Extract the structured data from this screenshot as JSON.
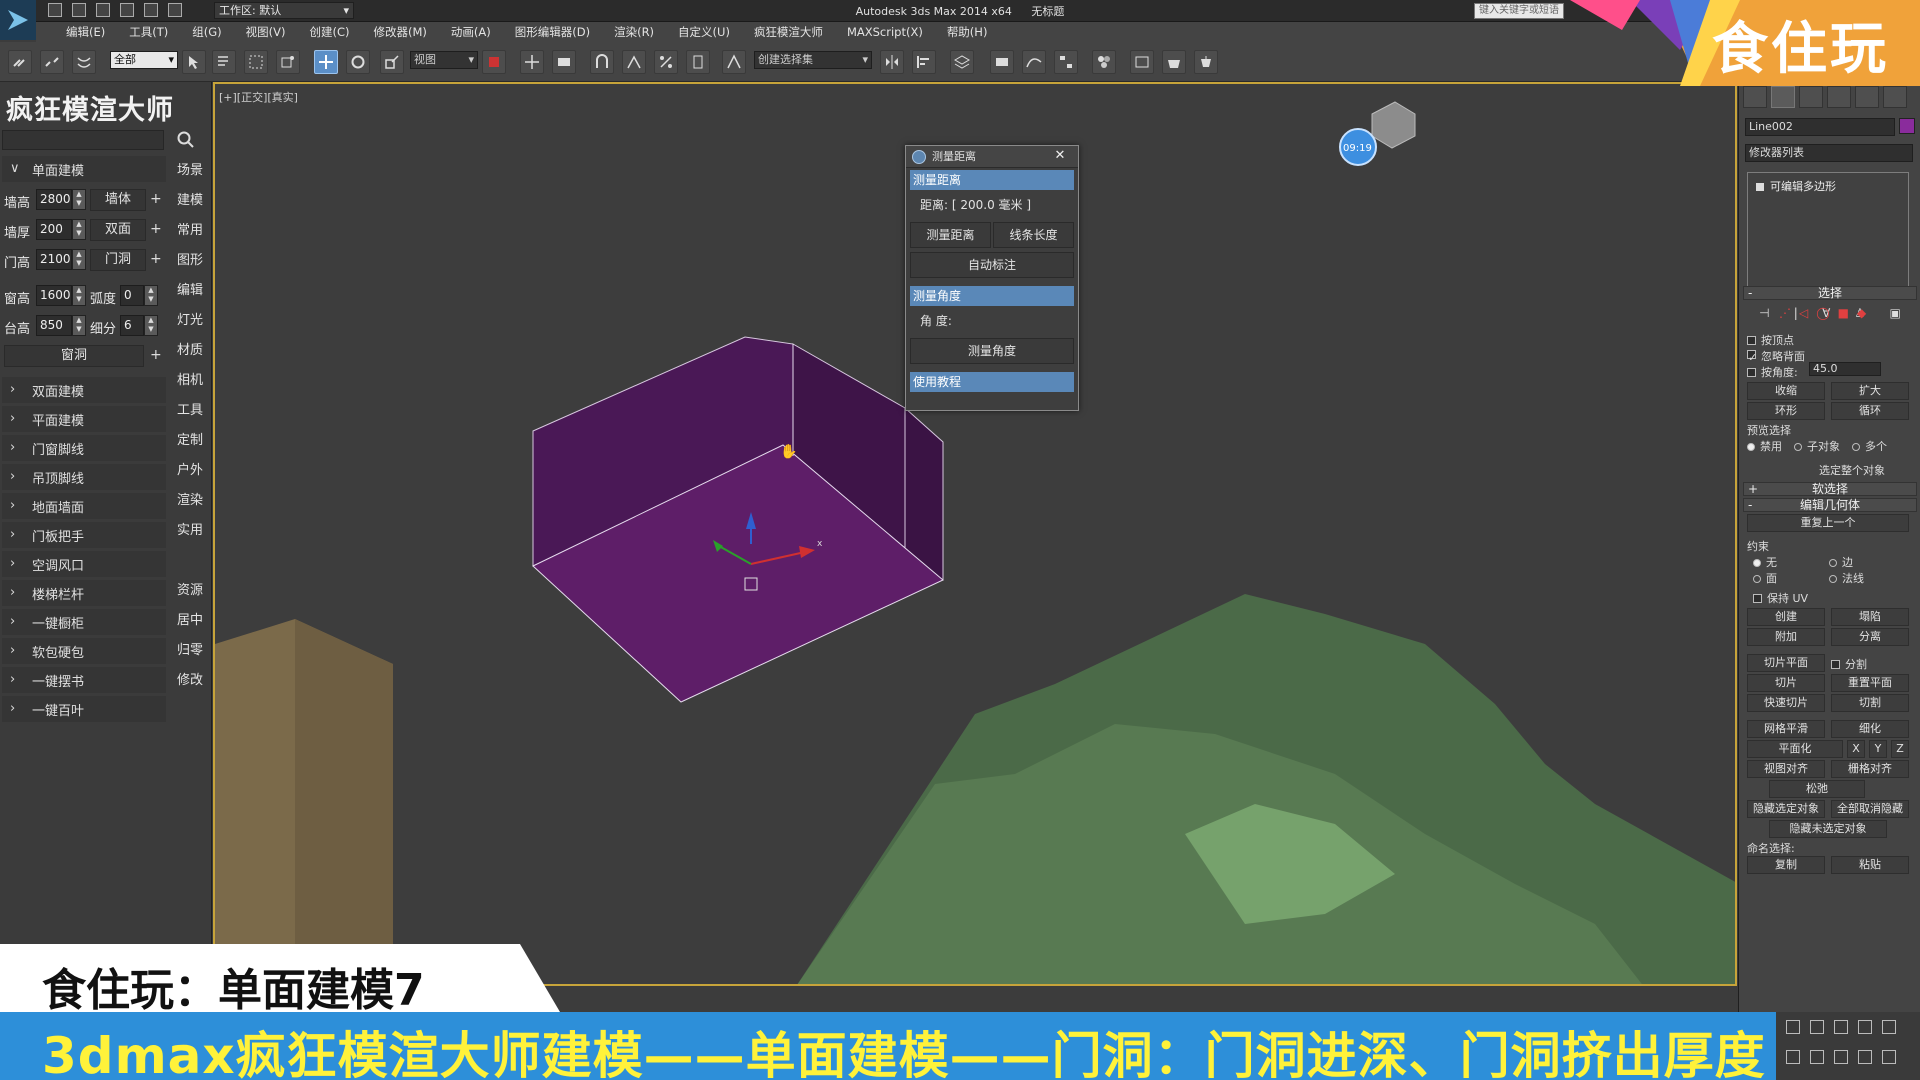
{
  "app": {
    "title_app": "Autodesk 3ds Max  2014 x64",
    "title_file": "无标题",
    "workspace": "工作区: 默认",
    "help_search_placeholder": "键入关键字或短语"
  },
  "menu": [
    "编辑(E)",
    "工具(T)",
    "组(G)",
    "视图(V)",
    "创建(C)",
    "修改器(M)",
    "动画(A)",
    "图形编辑器(D)",
    "渲染(R)",
    "自定义(U)",
    "疯狂模渲大师",
    "MAXScript(X)",
    "帮助(H)"
  ],
  "toolbar": {
    "filter_select": "全部",
    "ref_coord_select": "视图",
    "named_selection": "创建选择集"
  },
  "left_panel": {
    "title": "疯狂模渲大师",
    "section_single": "单面建模",
    "params": {
      "wall_height_label": "墙高",
      "wall_height_value": "2800",
      "wall_body": "墙体",
      "wall_thick_label": "墙厚",
      "wall_thick_value": "200",
      "double_face": "双面",
      "door_height_label": "门高",
      "door_height_value": "2100",
      "door_hole": "门洞",
      "window_height_label": "窗高",
      "window_height_value": "1600",
      "arc_label": "弧度",
      "arc_value": "0",
      "sill_height_label": "台高",
      "sill_height_value": "850",
      "subdiv_label": "细分",
      "subdiv_value": "6",
      "window_hole": "窗洞"
    },
    "sections": [
      "双面建模",
      "平面建模",
      "门窗脚线",
      "吊顶脚线",
      "地面墙面",
      "门板把手",
      "空调风口",
      "楼梯栏杆",
      "一键橱柜",
      "软包硬包",
      "一键摆书",
      "一键百叶"
    ],
    "categories_top": [
      "场景",
      "建模",
      "常用",
      "图形",
      "编辑",
      "灯光",
      "材质",
      "相机",
      "工具",
      "定制",
      "户外",
      "渲染",
      "实用"
    ],
    "categories_bottom": [
      "资源",
      "居中",
      "归零",
      "修改"
    ]
  },
  "viewport": {
    "label": "[+][正交][真实]",
    "clock": "09:19",
    "axis_x": "x"
  },
  "measure_dialog": {
    "title": "测量距离",
    "section_distance": "测量距离",
    "distance_text": "距离: [ 200.0 毫米 ]",
    "btn_measure_distance": "测量距离",
    "btn_line_length": "线条长度",
    "btn_auto_dimension": "自动标注",
    "section_angle": "测量角度",
    "angle_text": "角 度:",
    "btn_measure_angle": "测量角度",
    "section_tutorial": "使用教程"
  },
  "command_panel": {
    "object_name": "Line002",
    "modifier_list": "修改器列表",
    "stack_item": "可编辑多边形",
    "rollout_selection": "选择",
    "by_vertex": "按顶点",
    "ignore_backfacing": "忽略背面",
    "by_angle": "按角度:",
    "angle_value": "45.0",
    "shrink": "收缩",
    "grow": "扩大",
    "ring": "环形",
    "loop": "循环",
    "preview_selection": "预览选择",
    "preview_off": "禁用",
    "preview_subobj": "子对象",
    "preview_multi": "多个",
    "select_whole": "选定整个对象",
    "rollout_soft": "软选择",
    "rollout_edit_geom": "编辑几何体",
    "repeat_last": "重复上一个",
    "constraints": "约束",
    "c_none": "无",
    "c_edge": "边",
    "c_face": "面",
    "c_normal": "法线",
    "preserve_uv": "保持 UV",
    "create": "创建",
    "collapse": "塌陷",
    "attach": "附加",
    "detach": "分离",
    "slice_plane": "切片平面",
    "split": "分割",
    "slice": "切片",
    "reset_plane": "重置平面",
    "quickslice": "快速切片",
    "cut": "切割",
    "meshsmooth": "网格平滑",
    "tessellate": "细化",
    "make_planar": "平面化",
    "x": "X",
    "y": "Y",
    "z": "Z",
    "view_align": "视图对齐",
    "grid_align": "栅格对齐",
    "relax": "松弛",
    "hide_selected": "隐藏选定对象",
    "unhide_all": "全部取消隐藏",
    "hide_unselected": "隐藏未选定对象",
    "named_sel": "命名选择:",
    "copy": "复制",
    "paste": "粘贴"
  },
  "brand": {
    "name": "食住玩"
  },
  "caption": "食住玩：单面建模7",
  "subtitle": "3dmax疯狂模渲大师建模——单面建模——门洞：门洞进深、门洞挤出厚度",
  "colors": {
    "accent_blue": "#5a88b8",
    "object_purple": "#5e1e68",
    "subtitle_bg": "#2d8fd9",
    "subtitle_text": "#fff23a",
    "viewport_border": "#c7a43a"
  }
}
